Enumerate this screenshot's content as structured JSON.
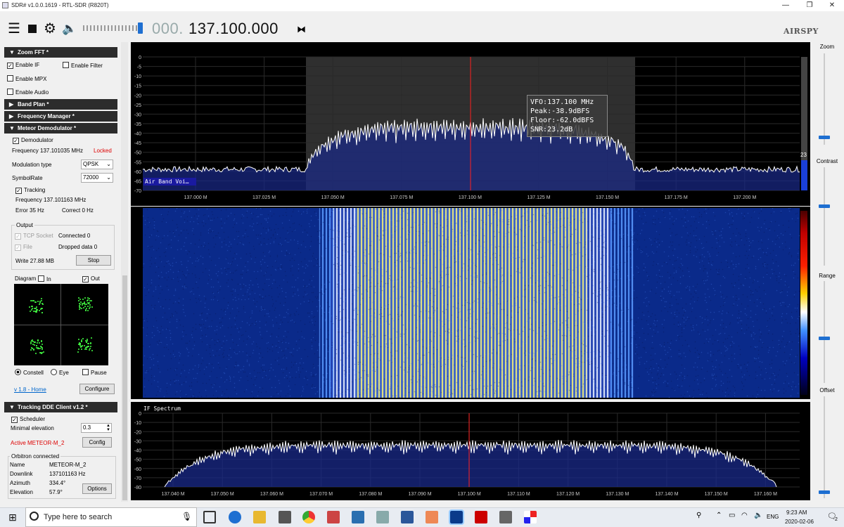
{
  "window": {
    "title": "SDR# v1.0.0.1619 - RTL-SDR (R820T)",
    "minimize": "—",
    "maximize": "❐",
    "close": "✕"
  },
  "toolbar": {
    "freq_dim": "000.",
    "freq_value": "137.100.000",
    "logo": "AIRSPY"
  },
  "left_panel": {
    "zoom_fft": {
      "header": "Zoom FFT *",
      "enable_if": "Enable IF",
      "enable_filter": "Enable Filter",
      "enable_mpx": "Enable MPX",
      "enable_audio": "Enable Audio"
    },
    "band_plan": "Band Plan *",
    "frequency_manager": "Frequency Manager *",
    "meteor": {
      "header": "Meteor Demodulator *",
      "demodulator": "Demodulator",
      "frequency": "Frequency 137.101035 MHz",
      "locked": "Locked",
      "modulation_label": "Modulation type",
      "modulation_value": "QPSK",
      "symbolrate_label": "SymbolRate",
      "symbolrate_value": "72000",
      "tracking": "Tracking",
      "tracking_freq": "Frequency 137.101163 MHz",
      "error": "Error 35 Hz",
      "correct": "Correct 0 Hz",
      "output_group": "Output",
      "tcp_socket": "TCP Socket",
      "connected": "Connected 0",
      "file": "File",
      "dropped": "Dropped data 0",
      "write": "Write 27.88 MB",
      "stop": "Stop",
      "diagram": "Diagram",
      "in": "In",
      "out": "Out",
      "constell": "Constell",
      "eye": "Eye",
      "pause": "Pause",
      "version_link": "v 1.8 - Home",
      "configure": "Configure"
    },
    "tracking_dde": {
      "header": "Tracking DDE Client v1.2 *",
      "scheduler": "Scheduler",
      "min_elev_label": "Minimal elevation",
      "min_elev_value": "0.3",
      "active": "Active METEOR-M_2",
      "config": "Config",
      "orbitron": "Orbitron connected",
      "name_label": "Name",
      "name_value": "METEOR-M_2",
      "downlink_label": "Downlink",
      "downlink_value": "137101163 Hz",
      "azimuth_label": "Azimuth",
      "azimuth_value": "334.4°",
      "elevation_label": "Elevation",
      "elevation_value": "57.9°",
      "options": "Options"
    }
  },
  "right_panel": {
    "zoom": "Zoom",
    "contrast": "Contrast",
    "range": "Range",
    "offset": "Offset"
  },
  "spectrum": {
    "vfo": "VFO:137.100 MHz",
    "peak": "Peak:-38.9dBFS",
    "floor": "Floor:-62.0dBFS",
    "snr": "SNR:23.2dB",
    "band_label": "Air Band Voi…",
    "snr_value": "23",
    "y_ticks": [
      "0",
      "-5",
      "-10",
      "-15",
      "-20",
      "-25",
      "-30",
      "-35",
      "-40",
      "-45",
      "-50",
      "-55",
      "-60",
      "-65",
      "-70"
    ],
    "x_ticks": [
      "137.000 M",
      "137.025 M",
      "137.050 M",
      "137.075 M",
      "137.100 M",
      "137.125 M",
      "137.150 M",
      "137.175 M",
      "137.200 M"
    ]
  },
  "if_spectrum": {
    "title": "IF Spectrum",
    "y_ticks": [
      "0",
      "-10",
      "-20",
      "-30",
      "-40",
      "-50",
      "-60",
      "-70",
      "-80"
    ],
    "x_ticks": [
      "137.040 M",
      "137.050 M",
      "137.060 M",
      "137.070 M",
      "137.080 M",
      "137.090 M",
      "137.100 M",
      "137.110 M",
      "137.120 M",
      "137.130 M",
      "137.140 M",
      "137.150 M",
      "137.160 M"
    ]
  },
  "taskbar": {
    "search_placeholder": "Type here to search",
    "time": "9:23 AM",
    "date": "2020-02-06",
    "lang": "ENG",
    "notif_count": "2"
  },
  "colors": {
    "accent": "#1e6fd1",
    "header_bg": "#2c2c2c",
    "locked": "#dd0000",
    "trace": "#ffffff",
    "vfo_line": "#ff2020"
  }
}
